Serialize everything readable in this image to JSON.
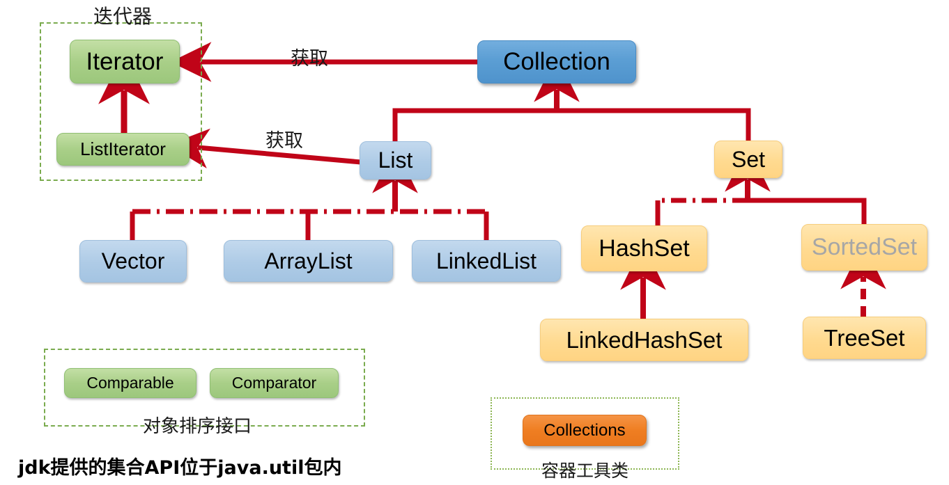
{
  "diagram": {
    "title_footnote": "jdk提供的集合API位于java.util包内",
    "accent_line_color": "#c00418",
    "group_border_color": "#7aab4e",
    "colors": {
      "green_node": "#a9cf88",
      "blue_node_strong": "#5b9ed4",
      "blue_node_light": "#aecbe6",
      "yellow_node": "#ffda90",
      "orange_node": "#ef7e22",
      "muted_text": "#a6a6a6"
    }
  },
  "groups": {
    "iterator": {
      "label": "迭代器"
    },
    "sorting": {
      "label": "对象排序接口"
    },
    "tools": {
      "label": "容器工具类"
    }
  },
  "nodes": {
    "iterator": "Iterator",
    "list_iterator": "ListIterator",
    "collection": "Collection",
    "list": "List",
    "set": "Set",
    "vector": "Vector",
    "array_list": "ArrayList",
    "linked_list": "LinkedList",
    "hash_set": "HashSet",
    "sorted_set": "SortedSet",
    "linked_hash_set": "LinkedHashSet",
    "tree_set": "TreeSet",
    "comparable": "Comparable",
    "comparator": "Comparator",
    "collections": "Collections"
  },
  "edges": {
    "collection_to_iterator": "获取",
    "list_to_listiterator": "获取"
  },
  "watermark": {
    "text": ""
  }
}
